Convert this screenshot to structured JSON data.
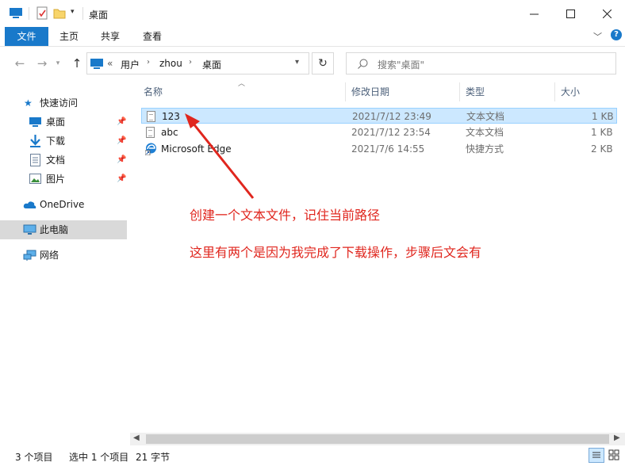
{
  "window": {
    "title": "桌面"
  },
  "ribbon": {
    "tabs": [
      "文件",
      "主页",
      "共享",
      "查看"
    ]
  },
  "address": {
    "separator": "«",
    "crumbs": [
      "用户",
      "zhou",
      "桌面"
    ]
  },
  "search": {
    "placeholder": "搜索\"桌面\""
  },
  "sidebar": {
    "quick_access": "快速访问",
    "items": [
      {
        "label": "桌面",
        "icon": "desktop-icon",
        "pinned": true
      },
      {
        "label": "下载",
        "icon": "download-icon",
        "pinned": true
      },
      {
        "label": "文档",
        "icon": "document-icon",
        "pinned": true
      },
      {
        "label": "图片",
        "icon": "picture-icon",
        "pinned": true
      }
    ],
    "onedrive": "OneDrive",
    "this_pc": "此电脑",
    "network": "网络"
  },
  "columns": {
    "name": "名称",
    "modified": "修改日期",
    "type": "类型",
    "size": "大小"
  },
  "files": [
    {
      "name": "123",
      "modified": "2021/7/12 23:49",
      "type": "文本文档",
      "size": "1 KB",
      "icon": "text-file-icon",
      "selected": true
    },
    {
      "name": "abc",
      "modified": "2021/7/12 23:54",
      "type": "文本文档",
      "size": "1 KB",
      "icon": "text-file-icon",
      "selected": false
    },
    {
      "name": "Microsoft Edge",
      "modified": "2021/7/6 14:55",
      "type": "快捷方式",
      "size": "2 KB",
      "icon": "edge-shortcut-icon",
      "selected": false
    }
  ],
  "annotations": {
    "line1": "创建一个文本文件，记住当前路径",
    "line2": "这里有两个是因为我完成了下载操作，步骤后文会有"
  },
  "status": {
    "count": "3 个项目",
    "selection": "选中 1 个项目",
    "size": "21 字节"
  },
  "colors": {
    "accent": "#1979ca",
    "selected_row": "#cce8ff",
    "annotation": "#e0261e"
  }
}
